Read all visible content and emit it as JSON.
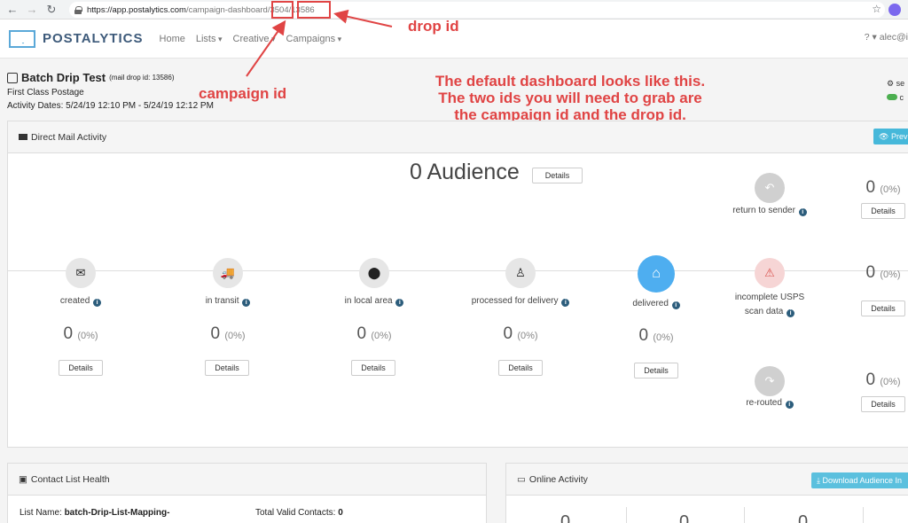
{
  "browser": {
    "url_host": "https://app.postalytics.com",
    "url_path": "/campaign-dashboard/3504/13586",
    "icons": [
      "back-icon",
      "forward-icon",
      "reload-icon",
      "lock-icon",
      "star-icon",
      "extension-icon"
    ]
  },
  "nav": {
    "brand": "POSTALYTICS",
    "links": [
      "Home",
      "Lists",
      "Creative",
      "Campaigns"
    ],
    "right_text": "? ▾  alec@i"
  },
  "header": {
    "title": "Batch Drip Test",
    "mail_drop_id": "(mail drop id: 13586)",
    "postage": "First Class Postage",
    "activity_dates": "Activity Dates: 5/24/19 12:10 PM - 5/24/19 12:12 PM",
    "right_cut_1": "se",
    "right_cut_2": "c"
  },
  "annotations": {
    "drop_id": "drop id",
    "campaign_id": "campaign id",
    "main": "The default dashboard looks like this. The two ids you will need to grab are the campaign id and the drop id.",
    "color": "#e04444"
  },
  "activity": {
    "heading": "Direct Mail Activity",
    "preview_label": "Previ",
    "audience_label": "0 Audience",
    "details_label": "Details",
    "steps": [
      {
        "label": "created",
        "count": "0",
        "pct": "(0%)",
        "icon": "envelope-icon"
      },
      {
        "label": "in transit",
        "count": "0",
        "pct": "(0%)",
        "icon": "truck-icon"
      },
      {
        "label": "in local area",
        "count": "0",
        "pct": "(0%)",
        "icon": "map-marker-icon"
      },
      {
        "label": "processed for delivery",
        "count": "0",
        "pct": "(0%)",
        "icon": "person-icon"
      },
      {
        "label": "delivered",
        "count": "0",
        "pct": "(0%)",
        "icon": "home-icon"
      }
    ],
    "side": [
      {
        "label": "return to sender",
        "count": "0",
        "pct": "(0%)",
        "icon": "reply-icon"
      },
      {
        "label_line1": "incomplete USPS",
        "label_line2": "scan data",
        "count": "0",
        "pct": "(0%)",
        "icon": "warning-icon"
      },
      {
        "label": "re-routed",
        "count": "0",
        "pct": "(0%)",
        "icon": "forward-arrow-icon"
      }
    ]
  },
  "contact_health": {
    "heading": "Contact List Health",
    "list_name_label": "List Name:",
    "list_name_value": "batch-Drip-List-Mapping-",
    "valid_label": "Total Valid Contacts:",
    "valid_value": "0"
  },
  "online_activity": {
    "heading": "Online Activity",
    "download_label": "Download Audience In",
    "zeros": [
      "0",
      "0",
      "0"
    ]
  }
}
